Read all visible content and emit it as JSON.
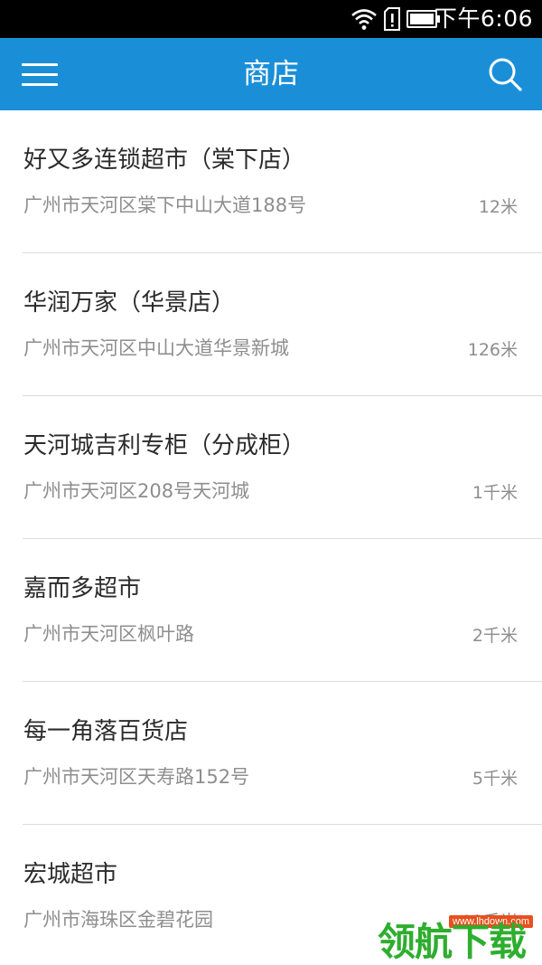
{
  "status_bar": {
    "time": "下午6:06",
    "icons": [
      "wifi-icon",
      "sim-alert-icon",
      "battery-icon"
    ]
  },
  "app_bar": {
    "title": "商店",
    "menu_icon": "hamburger-menu-icon",
    "search_icon": "search-icon"
  },
  "stores": [
    {
      "name": "好又多连锁超市（棠下店）",
      "address": "广州市天河区棠下中山大道188号",
      "distance": "12米"
    },
    {
      "name": "华润万家（华景店）",
      "address": "广州市天河区中山大道华景新城",
      "distance": "126米"
    },
    {
      "name": "天河城吉利专柜（分成柜）",
      "address": "广州市天河区208号天河城",
      "distance": "1千米"
    },
    {
      "name": "嘉而多超市",
      "address": "广州市天河区枫叶路",
      "distance": "2千米"
    },
    {
      "name": "每一角落百货店",
      "address": "广州市天河区天寿路152号",
      "distance": "5千米"
    },
    {
      "name": "宏城超市",
      "address": "广州市海珠区金碧花园",
      "distance": "12千米"
    }
  ],
  "watermark": {
    "url": "www.lhdown.com",
    "text": "领航下载"
  },
  "colors": {
    "app_bar": "#1a8fd8",
    "status_bar": "#000000",
    "title_text": "#2b2b2b",
    "secondary_text": "#8e8e8e",
    "divider": "#dcdcdc",
    "watermark_green": "#2eae2e"
  }
}
